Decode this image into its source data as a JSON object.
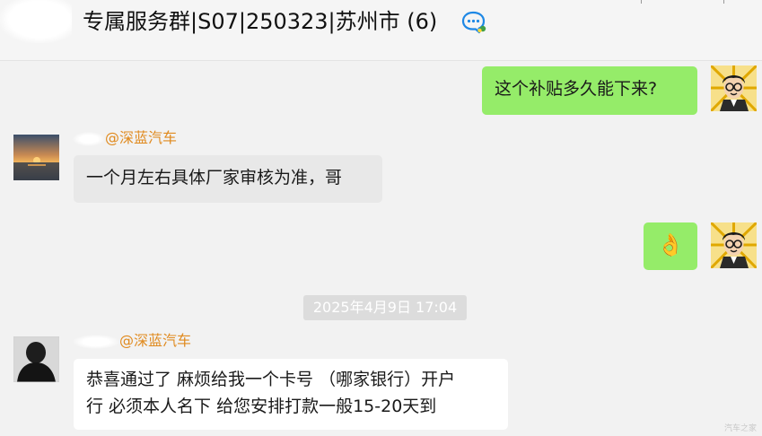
{
  "header": {
    "title": "专属服务群|S07|250323|苏州市 (6)",
    "icon": "chat-bubble-icon"
  },
  "messages": [
    {
      "id": "m1",
      "from": "me",
      "text": "这个补贴多久能下来?"
    },
    {
      "id": "m2",
      "from": "other",
      "sender": "@深蓝汽车",
      "text": "一个月左右具体厂家审核为准，哥"
    },
    {
      "id": "m3",
      "from": "me",
      "text": "👌"
    },
    {
      "id": "m4",
      "from": "other",
      "sender": "@深蓝汽车",
      "lines": [
        "恭喜通过了 麻烦给我一个卡号 （哪家银行）开户",
        "行 必须本人名下 给您安排打款一般15-20天到"
      ]
    }
  ],
  "timestamp": "2025年4月9日 17:04",
  "watermark": "汽车之家",
  "colors": {
    "my_bubble": "#95ec69",
    "sender_name": "#e08a1e",
    "background": "#f2f2f2"
  }
}
